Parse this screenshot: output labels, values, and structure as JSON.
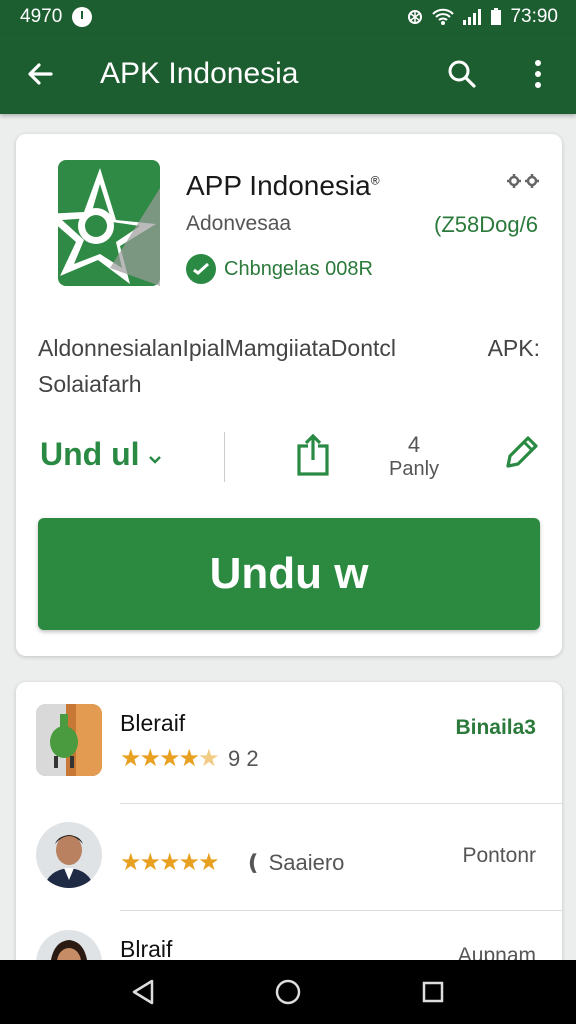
{
  "status_bar": {
    "left_text": "4970",
    "time": "73:90"
  },
  "app_bar": {
    "title": "APK Indonesia"
  },
  "app": {
    "name": "APP Indonesia",
    "name_mark": "®",
    "developer": "Adonvesaa",
    "size": "(Z58Dog/6",
    "verified_label": "Chbngelas 008R",
    "description_line1": "AldonnesialanIpialMamgiiataDontcl",
    "description_line2": "Solaiafarh",
    "description_apk": "APK:",
    "dropdown_label": "Und ul",
    "count_number": "4",
    "count_label": "Panly",
    "download_button": "Undu w"
  },
  "list": [
    {
      "name": "Bleraif",
      "rating_value": "9 2",
      "action": "Binaila3"
    },
    {
      "name": "",
      "meta": "Saaiero",
      "action": "Pontonr"
    },
    {
      "name": "Blraif",
      "action": "Aupnam"
    }
  ],
  "colors": {
    "primary_dark": "#1d5e31",
    "accent": "#2b8a40",
    "star": "#e8a021"
  },
  "icons": [
    "back-arrow-icon",
    "search-icon",
    "more-vert-icon",
    "share-icon",
    "edit-pencil-icon",
    "check-icon"
  ]
}
